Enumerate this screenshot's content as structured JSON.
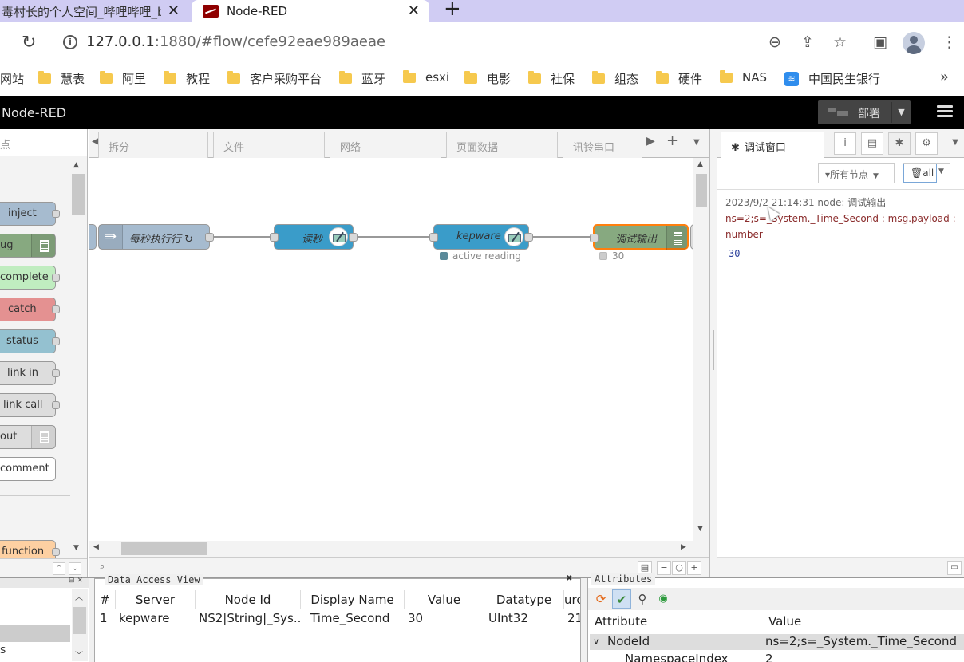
{
  "browser": {
    "tabs": [
      {
        "title": "毒村长的个人空间_哔哩哔哩_b",
        "close": "✕"
      },
      {
        "title": "Node-RED",
        "close": "✕"
      }
    ],
    "new_tab": "+",
    "url_host": "127.0.0.1",
    "url_rest": ":1880/#flow/cefe92eae989aeae",
    "bookmarks": [
      "网站",
      "慧表",
      "阿里",
      "教程",
      "客户采购平台",
      "蓝牙",
      "esxi",
      "电影",
      "社保",
      "组态",
      "硬件",
      "NAS",
      "中国民生银行"
    ],
    "bookmarks_more": "»"
  },
  "nodered": {
    "title": "Node-RED",
    "deploy_label": "部署"
  },
  "palette": {
    "search_placeholder": "点",
    "nodes": [
      "inject",
      "ug",
      "complete",
      "catch",
      "status",
      "link in",
      "link call",
      "out",
      "comment",
      "function"
    ]
  },
  "workspace": {
    "tabs": [
      "拆分",
      "文件",
      "网络",
      "页面数据",
      "讯铃串口"
    ],
    "flow_nodes": [
      {
        "label": "每秒执行行 ↻"
      },
      {
        "label": "读秒"
      },
      {
        "label": "kepware",
        "status": "active reading"
      },
      {
        "label": "调试输出",
        "status": "30"
      }
    ]
  },
  "sidebar": {
    "active_tab": "调试窗口",
    "filter_label": "所有节点",
    "clear_label": "all",
    "message": {
      "meta": "2023/9/2 21:14:31   node: 调试输出",
      "topic": "ns=2;s=_System._Time_Second : msg.payload : number",
      "value": "30"
    }
  },
  "data_access_view": {
    "title": "Data Access View",
    "columns": [
      "#",
      "Server",
      "Node Id",
      "Display Name",
      "Value",
      "Datatype",
      "urc"
    ],
    "rows": [
      [
        "1",
        "kepware",
        "NS2|String|_Sys...",
        "Time_Second",
        "30",
        "UInt32",
        "21"
      ]
    ]
  },
  "attributes": {
    "title": "Attributes",
    "col_attribute": "Attribute",
    "col_value": "Value",
    "rows": [
      {
        "name": "NodeId",
        "value": "ns=2;s=_System._Time_Second"
      },
      {
        "name": "NamespaceIndex",
        "value": "2"
      }
    ]
  }
}
